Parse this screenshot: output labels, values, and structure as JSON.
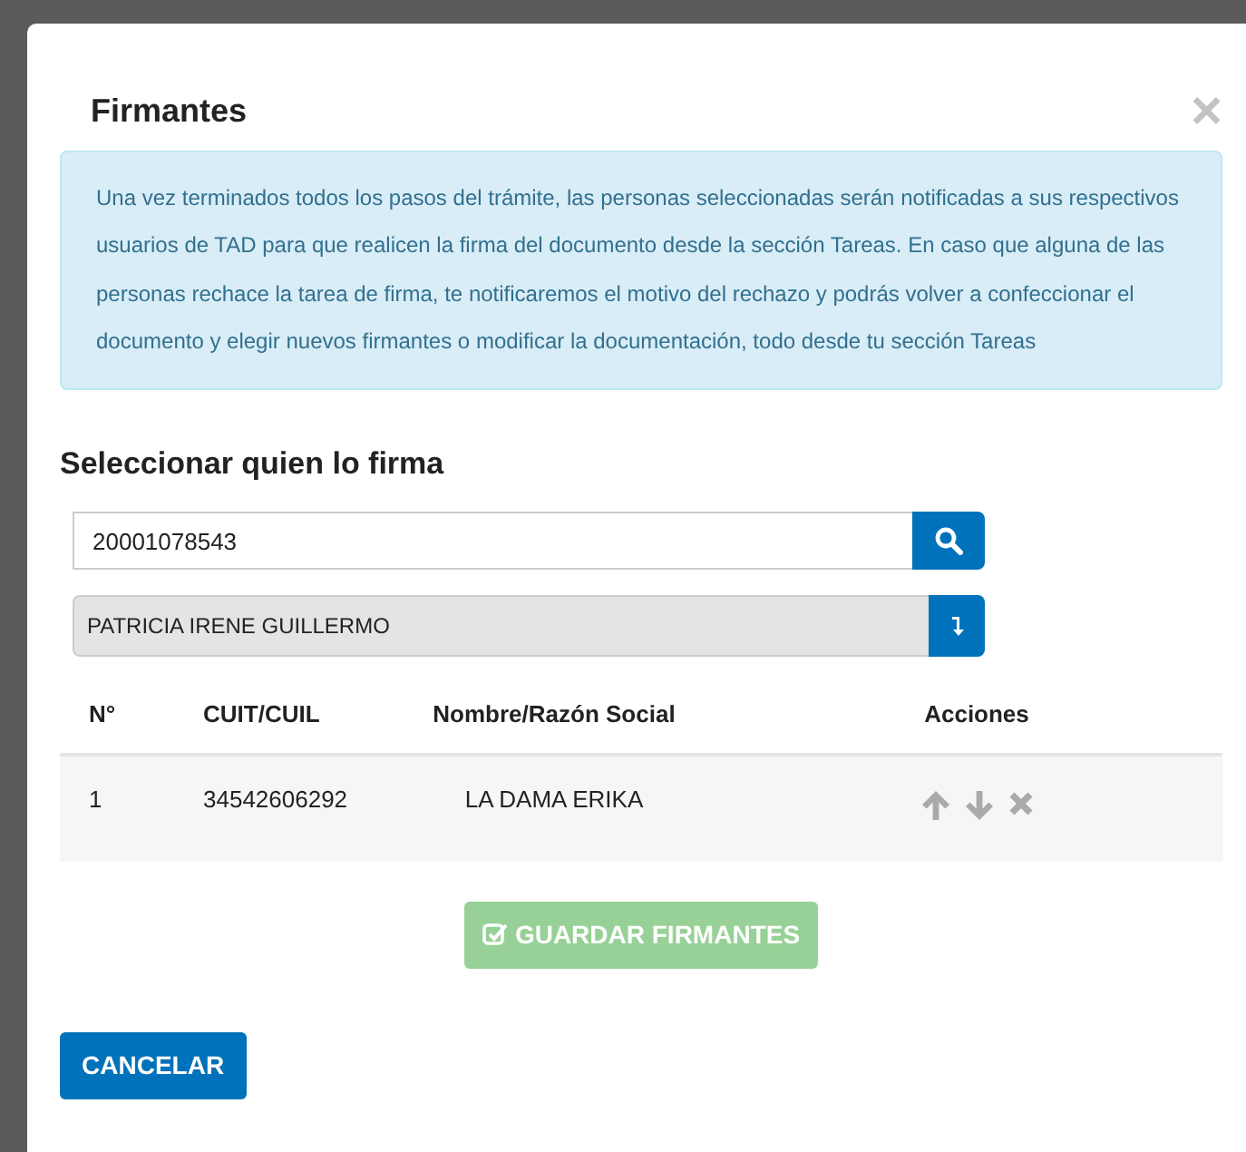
{
  "modal": {
    "title": "Firmantes",
    "close": "×"
  },
  "alert": {
    "text": "Una vez terminados todos los pasos del trámite, las personas seleccionadas serán notificadas a sus respectivos usuarios de TAD para que realicen la firma del documento desde la sección Tareas. En caso que alguna de las personas rechace la tarea de firma, te notificaremos el motivo del rechazo y podrás volver a confeccionar el documento y elegir nuevos firmantes o modificar la documentación, todo desde tu sección Tareas"
  },
  "section_title": "Seleccionar quien lo firma",
  "search": {
    "value": "20001078543"
  },
  "result": {
    "value": "PATRICIA IRENE GUILLERMO"
  },
  "table": {
    "columns": [
      "N°",
      "CUIT/CUIL",
      "Nombre/Razón Social",
      "Acciones"
    ],
    "rows": [
      {
        "n": "1",
        "cuit": "34542606292",
        "nombre": "LA DAMA ERIKA"
      }
    ]
  },
  "save_button": {
    "label": "GUARDAR FIRMANTES",
    "disabled": true
  },
  "cancel_button": {
    "label": "CANCELAR"
  }
}
